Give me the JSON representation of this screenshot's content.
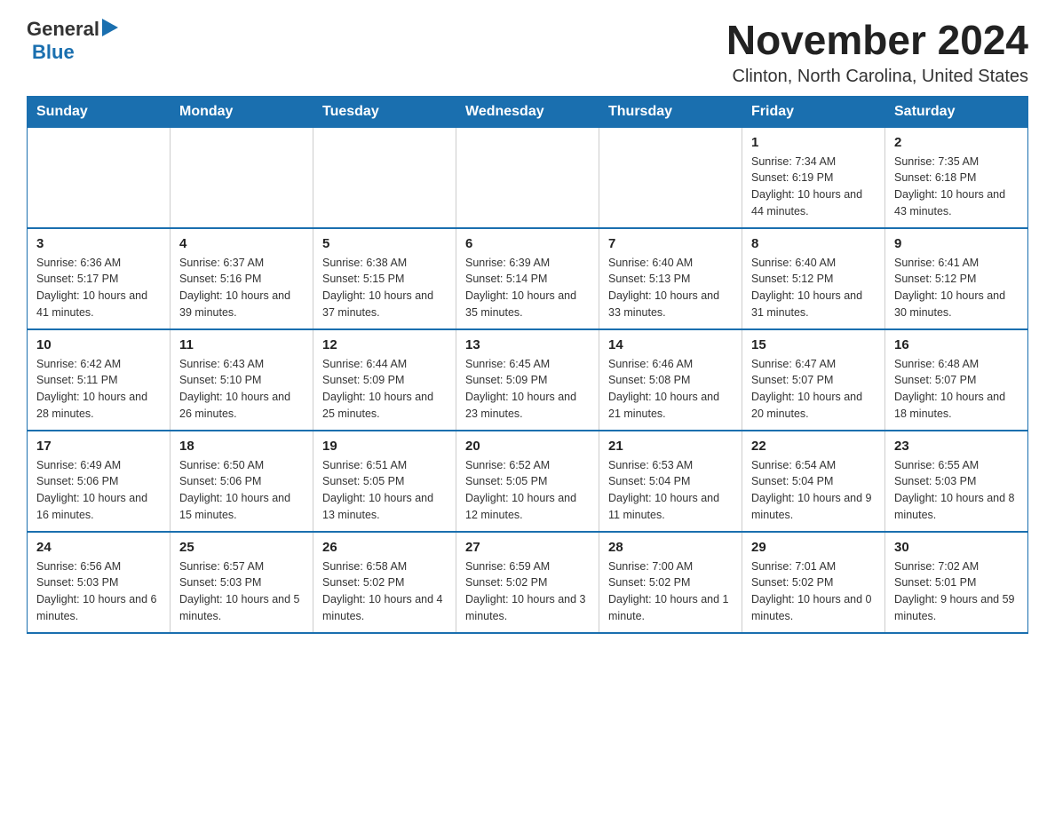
{
  "logo": {
    "general": "General",
    "blue": "Blue"
  },
  "title": "November 2024",
  "subtitle": "Clinton, North Carolina, United States",
  "days_of_week": [
    "Sunday",
    "Monday",
    "Tuesday",
    "Wednesday",
    "Thursday",
    "Friday",
    "Saturday"
  ],
  "weeks": [
    [
      {
        "day": "",
        "info": ""
      },
      {
        "day": "",
        "info": ""
      },
      {
        "day": "",
        "info": ""
      },
      {
        "day": "",
        "info": ""
      },
      {
        "day": "",
        "info": ""
      },
      {
        "day": "1",
        "info": "Sunrise: 7:34 AM\nSunset: 6:19 PM\nDaylight: 10 hours\nand 44 minutes."
      },
      {
        "day": "2",
        "info": "Sunrise: 7:35 AM\nSunset: 6:18 PM\nDaylight: 10 hours\nand 43 minutes."
      }
    ],
    [
      {
        "day": "3",
        "info": "Sunrise: 6:36 AM\nSunset: 5:17 PM\nDaylight: 10 hours\nand 41 minutes."
      },
      {
        "day": "4",
        "info": "Sunrise: 6:37 AM\nSunset: 5:16 PM\nDaylight: 10 hours\nand 39 minutes."
      },
      {
        "day": "5",
        "info": "Sunrise: 6:38 AM\nSunset: 5:15 PM\nDaylight: 10 hours\nand 37 minutes."
      },
      {
        "day": "6",
        "info": "Sunrise: 6:39 AM\nSunset: 5:14 PM\nDaylight: 10 hours\nand 35 minutes."
      },
      {
        "day": "7",
        "info": "Sunrise: 6:40 AM\nSunset: 5:13 PM\nDaylight: 10 hours\nand 33 minutes."
      },
      {
        "day": "8",
        "info": "Sunrise: 6:40 AM\nSunset: 5:12 PM\nDaylight: 10 hours\nand 31 minutes."
      },
      {
        "day": "9",
        "info": "Sunrise: 6:41 AM\nSunset: 5:12 PM\nDaylight: 10 hours\nand 30 minutes."
      }
    ],
    [
      {
        "day": "10",
        "info": "Sunrise: 6:42 AM\nSunset: 5:11 PM\nDaylight: 10 hours\nand 28 minutes."
      },
      {
        "day": "11",
        "info": "Sunrise: 6:43 AM\nSunset: 5:10 PM\nDaylight: 10 hours\nand 26 minutes."
      },
      {
        "day": "12",
        "info": "Sunrise: 6:44 AM\nSunset: 5:09 PM\nDaylight: 10 hours\nand 25 minutes."
      },
      {
        "day": "13",
        "info": "Sunrise: 6:45 AM\nSunset: 5:09 PM\nDaylight: 10 hours\nand 23 minutes."
      },
      {
        "day": "14",
        "info": "Sunrise: 6:46 AM\nSunset: 5:08 PM\nDaylight: 10 hours\nand 21 minutes."
      },
      {
        "day": "15",
        "info": "Sunrise: 6:47 AM\nSunset: 5:07 PM\nDaylight: 10 hours\nand 20 minutes."
      },
      {
        "day": "16",
        "info": "Sunrise: 6:48 AM\nSunset: 5:07 PM\nDaylight: 10 hours\nand 18 minutes."
      }
    ],
    [
      {
        "day": "17",
        "info": "Sunrise: 6:49 AM\nSunset: 5:06 PM\nDaylight: 10 hours\nand 16 minutes."
      },
      {
        "day": "18",
        "info": "Sunrise: 6:50 AM\nSunset: 5:06 PM\nDaylight: 10 hours\nand 15 minutes."
      },
      {
        "day": "19",
        "info": "Sunrise: 6:51 AM\nSunset: 5:05 PM\nDaylight: 10 hours\nand 13 minutes."
      },
      {
        "day": "20",
        "info": "Sunrise: 6:52 AM\nSunset: 5:05 PM\nDaylight: 10 hours\nand 12 minutes."
      },
      {
        "day": "21",
        "info": "Sunrise: 6:53 AM\nSunset: 5:04 PM\nDaylight: 10 hours\nand 11 minutes."
      },
      {
        "day": "22",
        "info": "Sunrise: 6:54 AM\nSunset: 5:04 PM\nDaylight: 10 hours\nand 9 minutes."
      },
      {
        "day": "23",
        "info": "Sunrise: 6:55 AM\nSunset: 5:03 PM\nDaylight: 10 hours\nand 8 minutes."
      }
    ],
    [
      {
        "day": "24",
        "info": "Sunrise: 6:56 AM\nSunset: 5:03 PM\nDaylight: 10 hours\nand 6 minutes."
      },
      {
        "day": "25",
        "info": "Sunrise: 6:57 AM\nSunset: 5:03 PM\nDaylight: 10 hours\nand 5 minutes."
      },
      {
        "day": "26",
        "info": "Sunrise: 6:58 AM\nSunset: 5:02 PM\nDaylight: 10 hours\nand 4 minutes."
      },
      {
        "day": "27",
        "info": "Sunrise: 6:59 AM\nSunset: 5:02 PM\nDaylight: 10 hours\nand 3 minutes."
      },
      {
        "day": "28",
        "info": "Sunrise: 7:00 AM\nSunset: 5:02 PM\nDaylight: 10 hours\nand 1 minute."
      },
      {
        "day": "29",
        "info": "Sunrise: 7:01 AM\nSunset: 5:02 PM\nDaylight: 10 hours\nand 0 minutes."
      },
      {
        "day": "30",
        "info": "Sunrise: 7:02 AM\nSunset: 5:01 PM\nDaylight: 9 hours\nand 59 minutes."
      }
    ]
  ]
}
